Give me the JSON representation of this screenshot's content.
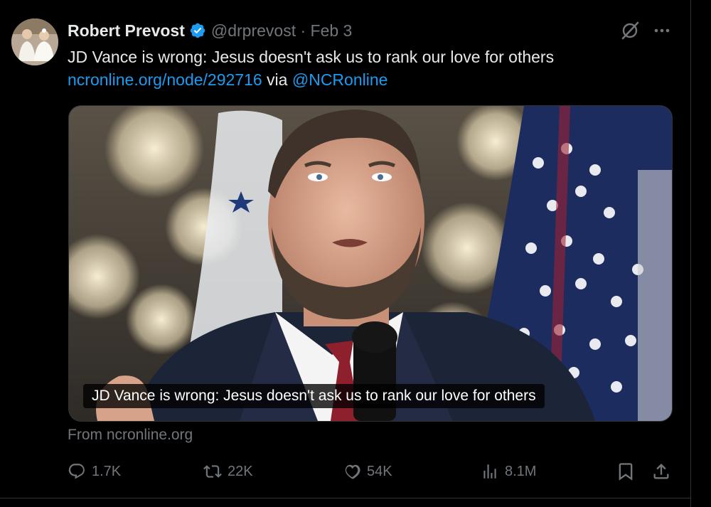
{
  "tweet": {
    "author_name": "Robert Prevost",
    "handle_date": "@drprevost · Feb 3",
    "text_line1": "JD Vance is wrong: Jesus doesn't ask us to rank our love for others",
    "link_text": "ncronline.org/node/292716",
    "via_text": " via ",
    "mention_text": "@NCRonline",
    "card_caption": "JD Vance is wrong: Jesus doesn't ask us to rank our love for others",
    "card_source": "From ncronline.org"
  },
  "actions": {
    "replies": "1.7K",
    "reposts": "22K",
    "likes": "54K",
    "views": "8.1M"
  },
  "colors": {
    "background": "#000000",
    "text": "#e7e9ea",
    "muted": "#71767b",
    "link": "#1d9bf0",
    "verified": "#1d9bf0"
  },
  "icons": [
    "grok-icon",
    "more-icon",
    "verified-badge-icon",
    "reply-icon",
    "repost-icon",
    "like-icon",
    "views-icon",
    "bookmark-icon",
    "share-icon"
  ]
}
